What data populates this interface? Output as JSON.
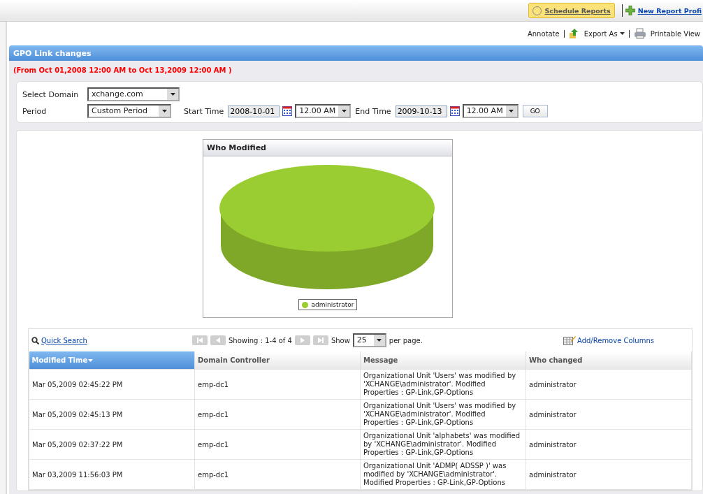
{
  "top_bar": {
    "schedule_button": "Schedule Reports",
    "new_report_link": "New Report Profi"
  },
  "actions": {
    "annotate": "Annotate",
    "export": "Export As",
    "printable": "Printable View"
  },
  "report": {
    "title": "GPO Link changes",
    "range": "(From Oct 01,2008 12:00 AM to Oct 13,2009 12:00 AM )"
  },
  "filters": {
    "domain_label": "Select Domain",
    "domain": "xchange.com",
    "period_label": "Period",
    "period": "Custom Period",
    "start_label": "Start Time",
    "start_date": "2008-10-01",
    "start_time": "12.00 AM",
    "end_label": "End Time",
    "end_date": "2009-10-13",
    "end_time": "12.00 AM",
    "go": "GO"
  },
  "chart": {
    "title": "Who Modified",
    "legend": [
      "administrator"
    ]
  },
  "toolbar": {
    "quick_search": "Quick Search",
    "showing": "Showing : 1-4 of 4",
    "show_label": "Show",
    "page_size": "25",
    "per_page": "per page.",
    "columns_link": "Add/Remove Columns"
  },
  "table": {
    "columns": [
      {
        "label": "Modified Time",
        "sorted": true
      },
      {
        "label": "Domain Controller",
        "sorted": false
      },
      {
        "label": "Message",
        "sorted": false
      },
      {
        "label": "Who changed",
        "sorted": false
      }
    ],
    "rows": [
      [
        "Mar 05,2009 02:45:22 PM",
        "emp-dc1",
        "Organizational Unit 'Users' was modified by 'XCHANGE\\administrator'. Modified Properties : GP-Link,GP-Options",
        "administrator"
      ],
      [
        "Mar 05,2009 02:45:13 PM",
        "emp-dc1",
        "Organizational Unit 'Users' was modified by 'XCHANGE\\administrator'. Modified Properties : GP-Link,GP-Options",
        "administrator"
      ],
      [
        "Mar 05,2009 02:37:22 PM",
        "emp-dc1",
        "Organizational Unit 'alphabets' was modified by 'XCHANGE\\administrator'. Modified Properties : GP-Link,GP-Options",
        "administrator"
      ],
      [
        "Mar 03,2009 11:56:03 PM",
        "emp-dc1",
        "Organizational Unit 'ADMP( ADSSP )' was modified by 'XCHANGE\\administrator'. Modified Properties : GP-Link,GP-Options",
        "administrator"
      ]
    ]
  }
}
